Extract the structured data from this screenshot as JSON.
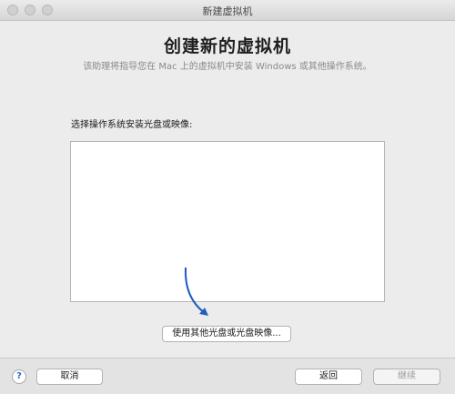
{
  "window": {
    "title": "新建虚拟机"
  },
  "header": {
    "title": "创建新的虚拟机",
    "subtitle": "该助理将指导您在 Mac 上的虚拟机中安装 Windows 或其他操作系统。"
  },
  "content": {
    "prompt_label": "选择操作系统安装光盘或映像:",
    "use_other_button_label": "使用其他光盘或光盘映像...",
    "arrow_color": "#1f5fbf"
  },
  "footer": {
    "help_label": "?",
    "cancel_label": "取消",
    "back_label": "返回",
    "continue_label": "继续"
  }
}
